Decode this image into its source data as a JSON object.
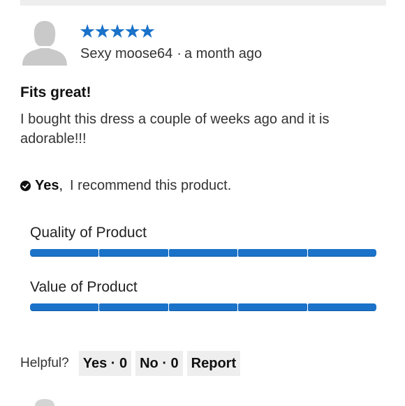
{
  "review": {
    "rating": 5,
    "rating_max": 5,
    "star_glyph": "★",
    "star_color": "#1a72c9",
    "author": "Sexy moose64",
    "separator": "·",
    "time_ago": "a month ago",
    "title": "Fits great!",
    "body": "I bought this dress a couple of weeks ago and it is adorable!!!",
    "recommend": {
      "icon": "check-circle-icon",
      "answer": "Yes",
      "comma": ",",
      "text": "I recommend this product."
    },
    "ratings": [
      {
        "label": "Quality of Product",
        "value": 5,
        "max": 5
      },
      {
        "label": "Value of Product",
        "value": 5,
        "max": 5
      }
    ],
    "bar_color": "#1a72c9"
  },
  "helpful": {
    "label": "Helpful?",
    "yes_label": "Yes · 0",
    "no_label": "No · 0",
    "report_label": "Report"
  }
}
